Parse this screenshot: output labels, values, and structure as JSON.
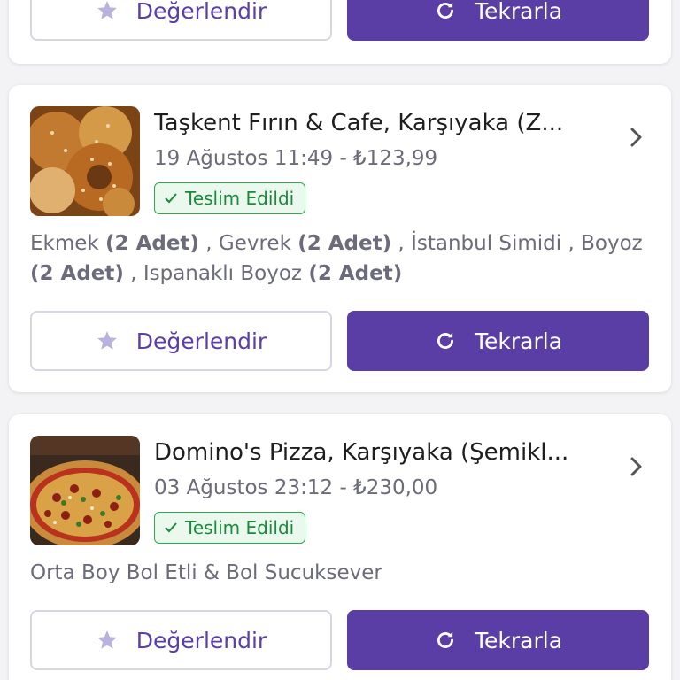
{
  "colors": {
    "brand_purple": "#5a3ea6",
    "delivered_green": "#1a8a3a",
    "star_lavender": "#b9b2dd"
  },
  "top_card": {
    "rate_label": "Değerlendir",
    "repeat_label": "Tekrarla"
  },
  "orders": [
    {
      "restaurant": "Taşkent Fırın & Cafe, Karşıyaka (Z...",
      "date_price": "19 Ağustos 11:49 - ₺123,99",
      "status": "Teslim Edildi",
      "thumbnail": "bakery-bread-image",
      "items": [
        {
          "name": "Ekmek",
          "qty": "(2 Adet)"
        },
        {
          "name": "Gevrek",
          "qty": "(2 Adet)"
        },
        {
          "name": "İstanbul Simidi",
          "qty": ""
        },
        {
          "name": "Boyoz",
          "qty": "(2 Adet)"
        },
        {
          "name": "Ispanaklı Boyoz",
          "qty": "(2 Adet)"
        }
      ],
      "rate_label": "Değerlendir",
      "repeat_label": "Tekrarla"
    },
    {
      "restaurant": "Domino's Pizza, Karşıyaka (Şemikl...",
      "date_price": "03 Ağustos 23:12 - ₺230,00",
      "status": "Teslim Edildi",
      "thumbnail": "pizza-image",
      "items": [
        {
          "name": "Orta Boy Bol Etli & Bol Sucuksever",
          "qty": ""
        }
      ],
      "rate_label": "Değerlendir",
      "repeat_label": "Tekrarla"
    }
  ],
  "icons": {
    "rate": "star-icon",
    "repeat": "refresh-icon",
    "open": "chevron-right-icon",
    "status": "check-icon"
  }
}
